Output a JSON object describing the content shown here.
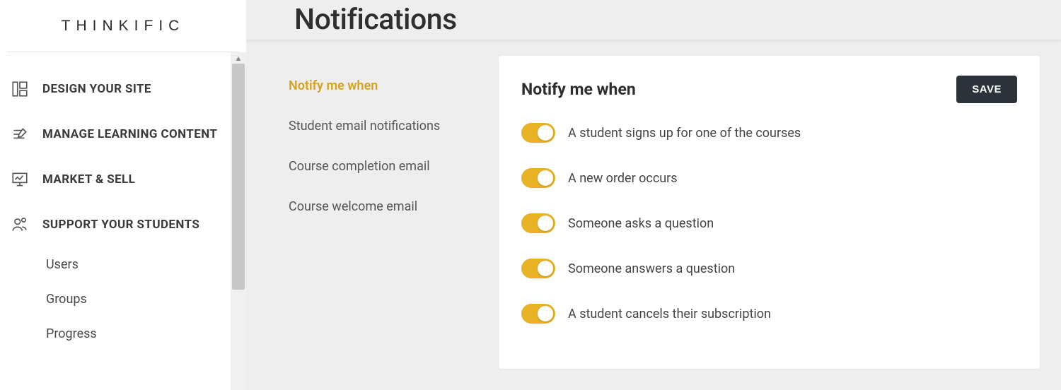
{
  "brand": "THINKIFIC",
  "sidebar": {
    "items": [
      {
        "label": "DESIGN YOUR SITE"
      },
      {
        "label": "MANAGE LEARNING CONTENT"
      },
      {
        "label": "MARKET & SELL"
      },
      {
        "label": "SUPPORT YOUR STUDENTS"
      }
    ],
    "sub_items": [
      {
        "label": "Users"
      },
      {
        "label": "Groups"
      },
      {
        "label": "Progress"
      }
    ]
  },
  "page": {
    "title": "Notifications"
  },
  "subnav": {
    "items": [
      {
        "label": "Notify me when",
        "active": true
      },
      {
        "label": "Student email notifications",
        "active": false
      },
      {
        "label": "Course completion email",
        "active": false
      },
      {
        "label": "Course welcome email",
        "active": false
      }
    ]
  },
  "card": {
    "title": "Notify me when",
    "save_label": "SAVE",
    "toggles": [
      {
        "label": "A student signs up for one of the courses",
        "on": true
      },
      {
        "label": "A new order occurs",
        "on": true
      },
      {
        "label": "Someone asks a question",
        "on": true
      },
      {
        "label": "Someone answers a question",
        "on": true
      },
      {
        "label": "A student cancels their subscription",
        "on": true
      }
    ]
  }
}
